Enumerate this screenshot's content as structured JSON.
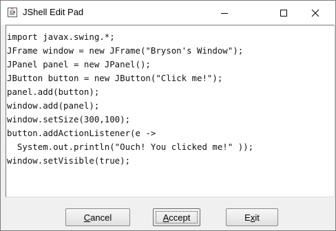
{
  "window": {
    "title": "JShell Edit Pad",
    "icon": "java-cup-icon",
    "controls": {
      "minimize_icon": "minimize-icon",
      "maximize_icon": "maximize-icon",
      "close_icon": "close-icon"
    }
  },
  "editor": {
    "lines": [
      "import javax.swing.*;",
      "JFrame window = new JFrame(\"Bryson's Window\");",
      "JPanel panel = new JPanel();",
      "JButton button = new JButton(\"Click me!\");",
      "panel.add(button);",
      "window.add(panel);",
      "window.setSize(300,100);",
      "button.addActionListener(e ->",
      "  System.out.println(\"Ouch! You clicked me!\" ));",
      "window.setVisible(true);"
    ]
  },
  "buttons": {
    "cancel": {
      "mnemonic": "C",
      "rest": "ancel"
    },
    "accept": {
      "mnemonic": "A",
      "rest": "ccept"
    },
    "exit": {
      "first": "E",
      "mnemonic": "x",
      "rest": "it"
    }
  }
}
